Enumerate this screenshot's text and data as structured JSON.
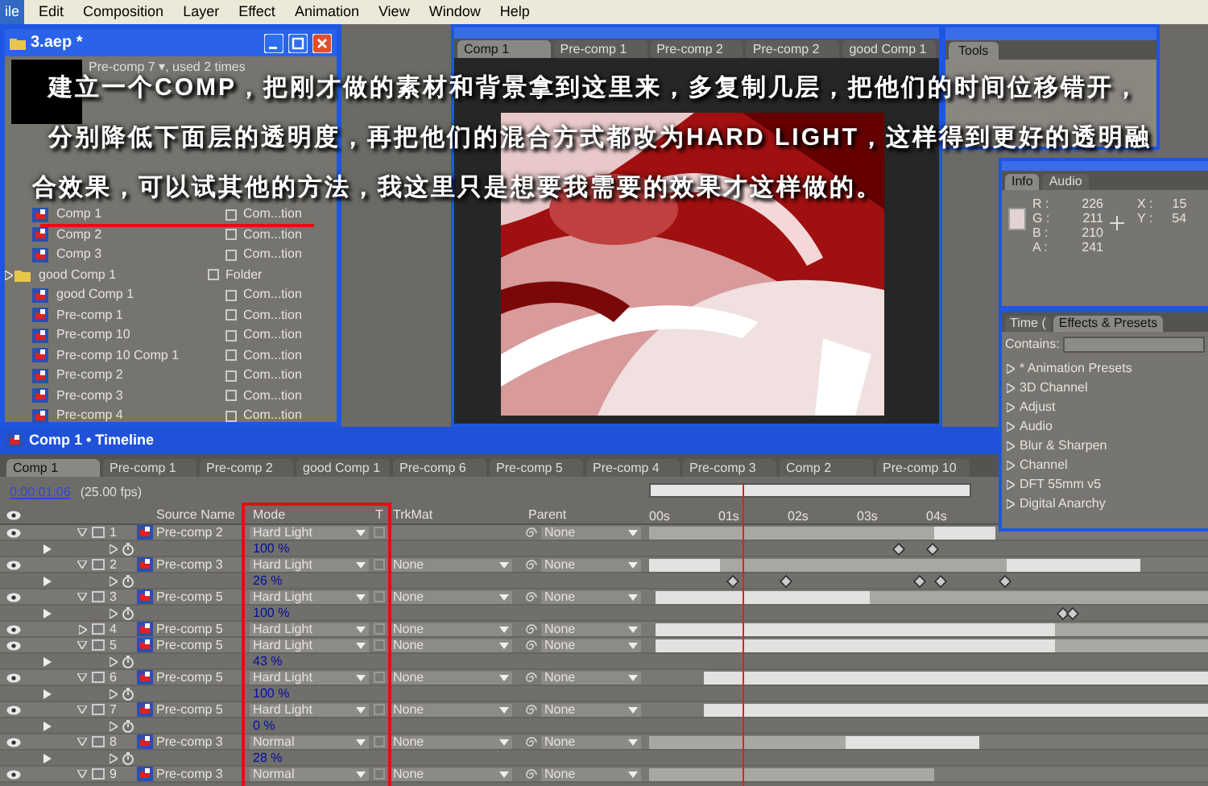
{
  "menu_bar": [
    {
      "label": "ile",
      "selected": true
    },
    {
      "label": "Edit",
      "selected": false
    },
    {
      "label": "Composition",
      "selected": false
    },
    {
      "label": "Layer",
      "selected": false
    },
    {
      "label": "Effect",
      "selected": false
    },
    {
      "label": "Animation",
      "selected": false
    },
    {
      "label": "View",
      "selected": false
    },
    {
      "label": "Window",
      "selected": false
    },
    {
      "label": "Help",
      "selected": false
    }
  ],
  "project_window": {
    "title": "3.aep *",
    "preview_info": "Pre-comp 7 ▾, used 2 times",
    "items": [
      {
        "kind": "comp",
        "name": "Comp 1",
        "type": "Com...tion",
        "underlined": true
      },
      {
        "kind": "comp",
        "name": "Comp 2",
        "type": "Com...tion",
        "underlined": false
      },
      {
        "kind": "comp",
        "name": "Comp 3",
        "type": "Com...tion",
        "underlined": false
      },
      {
        "kind": "folder",
        "name": "good Comp 1",
        "type": "Folder",
        "underlined": false
      },
      {
        "kind": "comp",
        "name": "good Comp 1",
        "type": "Com...tion",
        "underlined": false
      },
      {
        "kind": "comp",
        "name": "Pre-comp 1",
        "type": "Com...tion",
        "underlined": false
      },
      {
        "kind": "comp",
        "name": "Pre-comp 10",
        "type": "Com...tion",
        "underlined": false
      },
      {
        "kind": "comp",
        "name": "Pre-comp 10 Comp 1",
        "type": "Com...tion",
        "underlined": false
      },
      {
        "kind": "comp",
        "name": "Pre-comp 2",
        "type": "Com...tion",
        "underlined": false
      },
      {
        "kind": "comp",
        "name": "Pre-comp 3",
        "type": "Com...tion",
        "underlined": false
      },
      {
        "kind": "comp",
        "name": "Pre-comp 4",
        "type": "Com...tion",
        "underlined": false
      }
    ]
  },
  "composition_window": {
    "tabs": [
      {
        "label": "Comp 1",
        "selected": true
      },
      {
        "label": "Pre-comp 1",
        "selected": false
      },
      {
        "label": "Pre-comp 2",
        "selected": false
      },
      {
        "label": "Pre-comp 2",
        "selected": false
      },
      {
        "label": "good Comp 1",
        "selected": false
      }
    ]
  },
  "tools_panel": {
    "title": "Tools"
  },
  "info_panel": {
    "tabs": [
      {
        "label": "Info",
        "selected": true
      },
      {
        "label": "Audio",
        "selected": false
      }
    ],
    "color_values": [
      {
        "label": "R :",
        "value": "226"
      },
      {
        "label": "G :",
        "value": "211"
      },
      {
        "label": "B :",
        "value": "210"
      },
      {
        "label": "A :",
        "value": "241"
      }
    ],
    "coordinates": [
      {
        "label": "X :",
        "value": "15"
      },
      {
        "label": "Y :",
        "value": "54"
      }
    ]
  },
  "effects_panel": {
    "tabs": [
      {
        "label": "Time (",
        "selected": false
      },
      {
        "label": "Effects & Presets",
        "selected": true
      }
    ],
    "search_label": "Contains:",
    "items": [
      "* Animation Presets",
      "3D Channel",
      "Adjust",
      "Audio",
      "Blur & Sharpen",
      "Channel",
      "DFT 55mm v5",
      "Digital Anarchy"
    ]
  },
  "timeline": {
    "title": "Comp 1 • Timeline",
    "tabs": [
      {
        "label": "Comp 1",
        "selected": true
      },
      {
        "label": "Pre-comp 1",
        "selected": false
      },
      {
        "label": "Pre-comp 2",
        "selected": false
      },
      {
        "label": "good Comp 1",
        "selected": false
      },
      {
        "label": "Pre-comp 6",
        "selected": false
      },
      {
        "label": "Pre-comp 5",
        "selected": false
      },
      {
        "label": "Pre-comp 4",
        "selected": false
      },
      {
        "label": "Pre-comp 3",
        "selected": false
      },
      {
        "label": "Comp 2",
        "selected": false
      },
      {
        "label": "Pre-comp 10",
        "selected": false
      }
    ],
    "current_time": "0:00:01:06",
    "fps": "(25.00 fps)",
    "columns": {
      "source": "Source Name",
      "mode": "Mode",
      "t": "T",
      "trkmat": "TrkMat",
      "parent": "Parent"
    },
    "mode_column_highlighted": true,
    "ruler": [
      "00s",
      "01s",
      "02s",
      "03s",
      "04s"
    ],
    "layers": [
      {
        "number": "1",
        "name": "Pre-comp 2",
        "mode": "Hard Light",
        "parent": "None",
        "expanded": true,
        "opacity": "100 %"
      },
      {
        "number": "2",
        "name": "Pre-comp 3",
        "mode": "Hard Light",
        "trkmat": "None",
        "parent": "None",
        "expanded": true,
        "opacity": "26 %"
      },
      {
        "number": "3",
        "name": "Pre-comp 5",
        "mode": "Hard Light",
        "trkmat": "None",
        "parent": "None",
        "expanded": true,
        "opacity": "100 %"
      },
      {
        "number": "4",
        "name": "Pre-comp 5",
        "mode": "Hard Light",
        "trkmat": "None",
        "parent": "None",
        "expanded": false
      },
      {
        "number": "5",
        "name": "Pre-comp 5",
        "mode": "Hard Light",
        "trkmat": "None",
        "parent": "None",
        "expanded": true,
        "opacity": "43 %"
      },
      {
        "number": "6",
        "name": "Pre-comp 5",
        "mode": "Hard Light",
        "trkmat": "None",
        "parent": "None",
        "expanded": true,
        "opacity": "100 %"
      },
      {
        "number": "7",
        "name": "Pre-comp 5",
        "mode": "Hard Light",
        "trkmat": "None",
        "parent": "None",
        "expanded": true,
        "opacity": "0 %"
      },
      {
        "number": "8",
        "name": "Pre-comp 3",
        "mode": "Normal",
        "trkmat": "None",
        "parent": "None",
        "expanded": true,
        "opacity": "28 %"
      },
      {
        "number": "9",
        "name": "Pre-comp 3",
        "mode": "Normal",
        "trkmat": "None",
        "parent": "None",
        "expanded": true
      }
    ]
  },
  "caption": [
    "建立一个COMP，把刚才做的素材和背景拿到这里来，多复制几层，把他们的时间位移错开，",
    "分别降低下面层的透明度，再把他们的混合方式都改为HARD LIGHT，这样得到更好的透明融",
    "合效果，可以试其他的方法，我这里只是想要我需要的效果才这样做的。"
  ]
}
